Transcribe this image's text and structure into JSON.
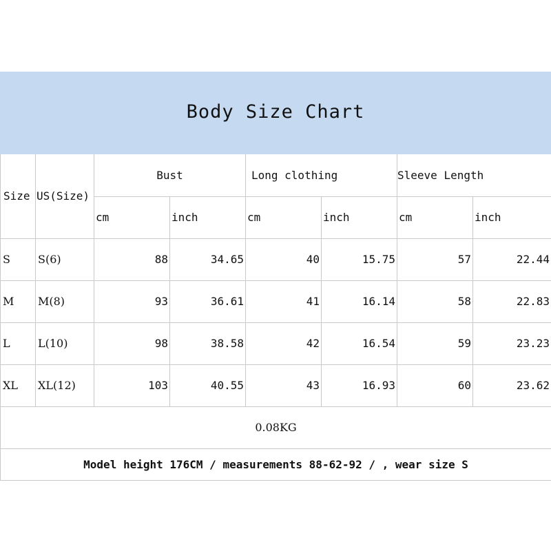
{
  "title": "Body Size Chart",
  "headers": {
    "size": "Size",
    "us_size": "US(Size)",
    "bust": "Bust",
    "long_clothing": "Long clothing",
    "sleeve_length": "Sleeve Length",
    "cm": "cm",
    "inch": "inch"
  },
  "rows": [
    {
      "size": "S",
      "us": "S(6)",
      "bust_cm": "88",
      "bust_in": "34.65",
      "long_cm": "40",
      "long_in": "15.75",
      "sleeve_cm": "57",
      "sleeve_in": "22.44"
    },
    {
      "size": "M",
      "us": "M(8)",
      "bust_cm": "93",
      "bust_in": "36.61",
      "long_cm": "41",
      "long_in": "16.14",
      "sleeve_cm": "58",
      "sleeve_in": "22.83"
    },
    {
      "size": "L",
      "us": "L(10)",
      "bust_cm": "98",
      "bust_in": "38.58",
      "long_cm": "42",
      "long_in": "16.54",
      "sleeve_cm": "59",
      "sleeve_in": "23.23"
    },
    {
      "size": "XL",
      "us": "XL(12)",
      "bust_cm": "103",
      "bust_in": "40.55",
      "long_cm": "43",
      "long_in": "16.93",
      "sleeve_cm": "60",
      "sleeve_in": "23.62"
    }
  ],
  "weight": "0.08KG",
  "model_note": "Model height 176CM / measurements 88-62-92 / , wear size S",
  "colors": {
    "banner": "#c5d9f1",
    "grid": "#c9c9c9"
  }
}
